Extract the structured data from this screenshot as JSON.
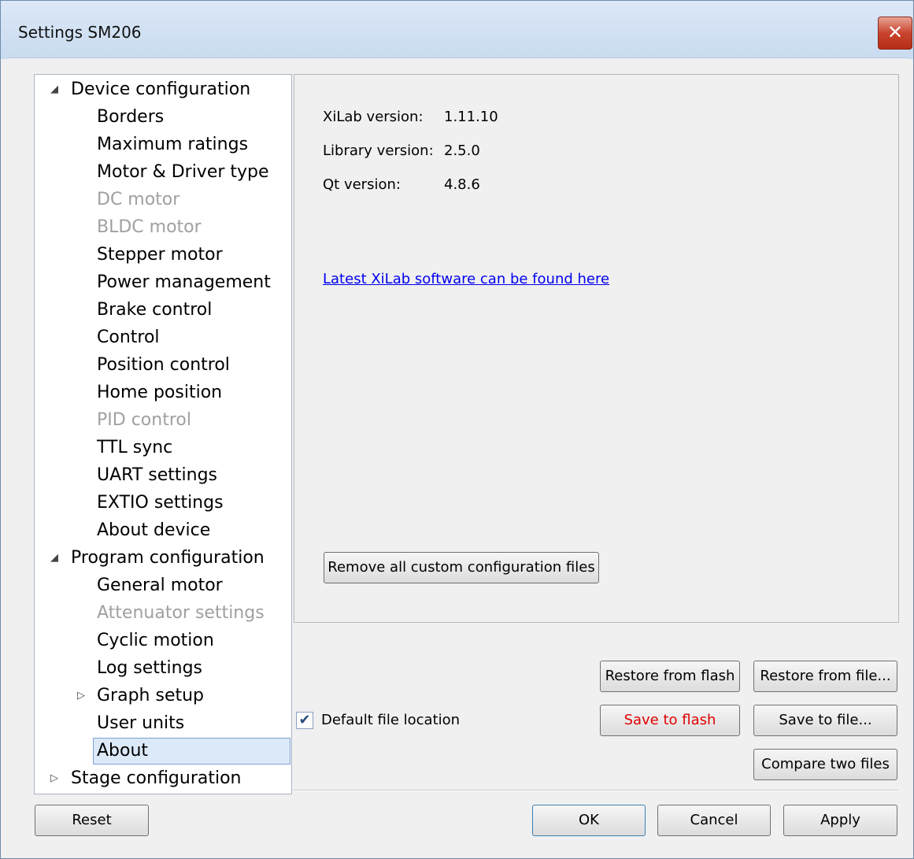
{
  "window": {
    "title": "Settings SM206",
    "close_glyph": "✕"
  },
  "tree": {
    "groups": [
      {
        "label": "Device configuration",
        "expanded": true
      },
      {
        "label": "Program configuration",
        "expanded": true
      },
      {
        "label": "Stage configuration",
        "expanded": false
      }
    ],
    "device_items": [
      {
        "label": "Borders",
        "enabled": true
      },
      {
        "label": "Maximum ratings",
        "enabled": true
      },
      {
        "label": "Motor & Driver type",
        "enabled": true
      },
      {
        "label": "DC motor",
        "enabled": false
      },
      {
        "label": "BLDC motor",
        "enabled": false
      },
      {
        "label": "Stepper motor",
        "enabled": true
      },
      {
        "label": "Power management",
        "enabled": true
      },
      {
        "label": "Brake control",
        "enabled": true
      },
      {
        "label": "Control",
        "enabled": true
      },
      {
        "label": "Position control",
        "enabled": true
      },
      {
        "label": "Home position",
        "enabled": true
      },
      {
        "label": "PID control",
        "enabled": false
      },
      {
        "label": "TTL sync",
        "enabled": true
      },
      {
        "label": "UART settings",
        "enabled": true
      },
      {
        "label": "EXTIO settings",
        "enabled": true
      },
      {
        "label": "About device",
        "enabled": true
      }
    ],
    "program_items": [
      {
        "label": "General motor",
        "enabled": true
      },
      {
        "label": "Attenuator settings",
        "enabled": false
      },
      {
        "label": "Cyclic motion",
        "enabled": true
      },
      {
        "label": "Log settings",
        "enabled": true
      },
      {
        "label": "Graph setup",
        "enabled": true,
        "collapsed_children": true
      },
      {
        "label": "User units",
        "enabled": true
      },
      {
        "label": "About",
        "enabled": true,
        "selected": true
      }
    ]
  },
  "about": {
    "xilab_label": "XiLab version:",
    "xilab_value": "1.11.10",
    "library_label": "Library version:",
    "library_value": "2.5.0",
    "qt_label": "Qt version:",
    "qt_value": "4.8.6",
    "link_text": "Latest XiLab software can be found here",
    "remove_button": "Remove all custom configuration files"
  },
  "file_actions": {
    "restore_flash": "Restore from flash",
    "restore_file": "Restore from file...",
    "save_flash": "Save to flash",
    "save_file": "Save to file...",
    "compare": "Compare two files",
    "default_location_label": "Default file location",
    "default_location_checked": true
  },
  "dialog_buttons": {
    "reset": "Reset",
    "ok": "OK",
    "cancel": "Cancel",
    "apply": "Apply"
  },
  "colors": {
    "save_flash_text": "#e00000",
    "disabled_text": "#a0a0a0",
    "link": "#0000ee",
    "selection": "#dce9f8"
  }
}
